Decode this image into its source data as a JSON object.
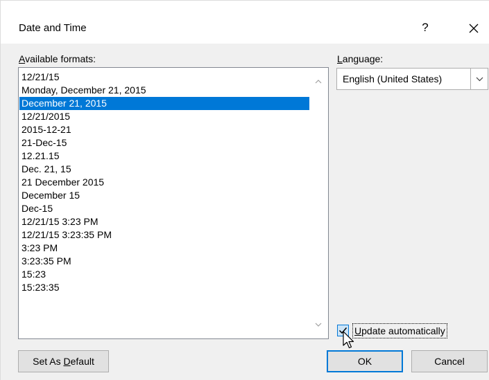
{
  "dialog": {
    "title": "Date and Time",
    "help_label": "?",
    "close_label": "✕"
  },
  "formats": {
    "label_prefix": "",
    "label_accel": "A",
    "label_rest": "vailable formats:",
    "items": [
      "12/21/15",
      "Monday, December 21, 2015",
      "December 21, 2015",
      "12/21/2015",
      "2015-12-21",
      "21-Dec-15",
      "12.21.15",
      "Dec. 21, 15",
      "21 December 2015",
      "December 15",
      "Dec-15",
      "12/21/15 3:23 PM",
      "12/21/15 3:23:35 PM",
      "3:23 PM",
      "3:23:35 PM",
      "15:23",
      "15:23:35"
    ],
    "selected_index": 2
  },
  "language": {
    "label_accel": "L",
    "label_rest": "anguage:",
    "selected": "English (United States)"
  },
  "update": {
    "label_accel": "U",
    "label_rest": "pdate automatically",
    "checked": true
  },
  "buttons": {
    "set_default_prefix": "Set As ",
    "set_default_accel": "D",
    "set_default_rest": "efault",
    "ok": "OK",
    "cancel": "Cancel"
  },
  "colors": {
    "selection": "#0078d7",
    "default_button_border": "#0078d7"
  }
}
